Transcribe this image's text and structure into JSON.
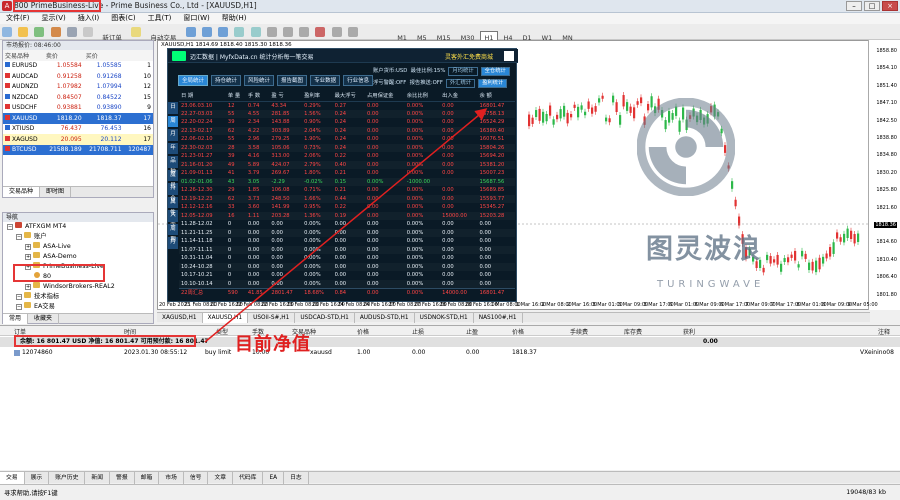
{
  "titlebar": {
    "icon": "A",
    "account": "800",
    "server": "PrimeBusiness-Live",
    "rest": " - Prime Business Co., Ltd - [XAUUSD,H1]"
  },
  "menu": [
    "文件(F)",
    "显示(V)",
    "插入(I)",
    "图表(C)",
    "工具(T)",
    "窗口(W)",
    "帮助(H)"
  ],
  "toolbar": {
    "new_order": "新订单",
    "auto_trade": "自动交易",
    "timeframes": [
      "M1",
      "M5",
      "M15",
      "M30",
      "H1",
      "H4",
      "D1",
      "W1",
      "MN"
    ]
  },
  "market": {
    "header": "市场报价: 08:46:00",
    "cols": [
      "交易品种",
      "卖价",
      "买价",
      ""
    ],
    "rows": [
      {
        "sym": "EURUSD",
        "bid": "1.05584",
        "ask": "1.05585",
        "sp": "1",
        "cls": ""
      },
      {
        "sym": "AUDCAD",
        "bid": "0.91258",
        "ask": "0.91268",
        "sp": "10",
        "cls": ""
      },
      {
        "sym": "AUDNZD",
        "bid": "1.07982",
        "ask": "1.07994",
        "sp": "12",
        "cls": ""
      },
      {
        "sym": "NZDCAD",
        "bid": "0.84507",
        "ask": "0.84522",
        "sp": "15",
        "cls": ""
      },
      {
        "sym": "USDCHF",
        "bid": "0.93881",
        "ask": "0.93890",
        "sp": "9",
        "cls": ""
      },
      {
        "sym": "XAUUSD",
        "bid": "1818.20",
        "ask": "1818.37",
        "sp": "17",
        "cls": "sel"
      },
      {
        "sym": "XTIUSD",
        "bid": "76.437",
        "ask": "76.453",
        "sp": "16",
        "cls": ""
      },
      {
        "sym": "XAGUSD",
        "bid": "20.095",
        "ask": "20.112",
        "sp": "17",
        "cls": "hl"
      },
      {
        "sym": "BTCUSD",
        "bid": "21588.189",
        "ask": "21708.711",
        "sp": "120487",
        "cls": "sel"
      }
    ],
    "tabs": [
      "交易品种",
      "即时图"
    ]
  },
  "navigator": {
    "header": "导航",
    "items": [
      {
        "label": "ATFXGM MT4",
        "indent": 0,
        "type": "root"
      },
      {
        "label": "账户",
        "indent": 1,
        "type": "folder"
      },
      {
        "label": "ASA-Live",
        "indent": 2,
        "type": "folder"
      },
      {
        "label": "ASA-Demo",
        "indent": 2,
        "type": "folder"
      },
      {
        "label": "PrimeBusiness-Live",
        "indent": 2,
        "type": "folder"
      },
      {
        "label": "80",
        "indent": 3,
        "type": "user"
      },
      {
        "label": "WindsorBrokers-REAL2",
        "indent": 2,
        "type": "folder"
      },
      {
        "label": "技术指标",
        "indent": 1,
        "type": "folder"
      },
      {
        "label": "EA交易",
        "indent": 1,
        "type": "folder"
      }
    ],
    "tabs": [
      "常用",
      "收藏夹"
    ]
  },
  "chart": {
    "title": "XAUUSD,H1  1814.69 1818.40 1815.30 1818.36",
    "price_labels": [
      "1858.80",
      "1854.10",
      "1851.40",
      "1847.10",
      "1842.50",
      "1838.80",
      "1834.80",
      "1830.20",
      "1825.80",
      "1821.60",
      "1818.36",
      "1814.60",
      "1810.40",
      "1806.40",
      "1801.80"
    ],
    "current_price": "1818.36",
    "time_labels": [
      "20 Feb 2023",
      "21 Feb 08:00",
      "21 Feb 16:00",
      "22 Feb 08:00",
      "22 Feb 16:00",
      "23 Feb 08:00",
      "23 Feb 16:00",
      "24 Feb 08:00",
      "24 Feb 16:00",
      "27 Feb 08:00",
      "27 Feb 16:00",
      "28 Feb 08:00",
      "28 Feb 16:00",
      "1 Mar 08:00",
      "1 Mar 16:00",
      "2 Mar 08:00",
      "2 Mar 16:00",
      "3 Mar 01:00",
      "3 Mar 09:00",
      "3 Mar 17:00",
      "6 Mar 01:00",
      "6 Mar 09:00",
      "6 Mar 17:00",
      "7 Mar 09:00",
      "7 Mar 17:00",
      "8 Mar 01:00",
      "8 Mar 09:00",
      "9 Mar 05:00"
    ],
    "watermark": {
      "cn": "图灵波浪",
      "en": "TURINGWAVE"
    }
  },
  "overlay": {
    "brand": "迈汇数据 | MyfxData.cn  统计分析每一笔交易",
    "promo": "灵客外汇免费商城",
    "nav_buttons": [
      "全局统计",
      "持仓统计",
      "风险统计",
      "报告截图",
      "专业数据",
      "行业信息"
    ],
    "stats": {
      "currency_label": "账户货币:USD",
      "margin_label": "最佳比例:15%",
      "chips1": [
        "月均统计",
        "全仓统计"
      ],
      "hedge_label": "浮亏警醒:OFF",
      "alert_label": "报告推送:OFF",
      "chips2": [
        "外汇统计",
        "盈利统计"
      ]
    },
    "side_tabs": [
      "日",
      "周",
      "月",
      "年",
      "品种",
      "魔号",
      "持仓",
      "属性",
      "大字",
      "周期",
      "月"
    ],
    "columns": [
      "日 期",
      "单 量",
      "手 数",
      "盈 亏",
      "盈利率",
      "最大浮亏",
      "占用保证金",
      "余比比例",
      "出入金",
      "余 额"
    ],
    "rows": [
      {
        "c": [
          "23.06.03.10",
          "12",
          "0.74",
          "43.34",
          "0.29%",
          "0.27",
          "0.00",
          "0.00%",
          "0.00",
          "16801.47"
        ],
        "k": "r"
      },
      {
        "c": [
          "22.27-03.03",
          "55",
          "4.55",
          "281.85",
          "1.56%",
          "0.24",
          "0.00",
          "0.00%",
          "0.00",
          "16758.13"
        ],
        "k": "r"
      },
      {
        "c": [
          "22.20-02.24",
          "39",
          "2.34",
          "143.88",
          "0.90%",
          "0.24",
          "0.00",
          "0.00%",
          "0.00",
          "16524.29"
        ],
        "k": "r"
      },
      {
        "c": [
          "22.13-02.17",
          "62",
          "4.22",
          "303.89",
          "2.04%",
          "0.24",
          "0.00",
          "0.00%",
          "0.00",
          "16380.40"
        ],
        "k": "r"
      },
      {
        "c": [
          "22.06-02.10",
          "55",
          "2.96",
          "279.25",
          "1.90%",
          "0.24",
          "0.00",
          "0.00%",
          "0.00",
          "16076.51"
        ],
        "k": "r"
      },
      {
        "c": [
          "22.30-02.03",
          "28",
          "3.58",
          "105.06",
          "0.73%",
          "0.24",
          "0.00",
          "0.00%",
          "0.00",
          "15804.26"
        ],
        "k": "r"
      },
      {
        "c": [
          "21.23-01.27",
          "39",
          "4.16",
          "313.00",
          "2.06%",
          "0.22",
          "0.00",
          "0.00%",
          "0.00",
          "15694.20"
        ],
        "k": "r"
      },
      {
        "c": [
          "21.16-01.20",
          "49",
          "5.89",
          "424.07",
          "2.79%",
          "0.40",
          "0.00",
          "0.00%",
          "0.00",
          "15381.20"
        ],
        "k": "r"
      },
      {
        "c": [
          "21.09-01.13",
          "41",
          "3.79",
          "269.67",
          "1.80%",
          "0.21",
          "0.00",
          "0.00%",
          "0.00",
          "15007.23"
        ],
        "k": "r"
      },
      {
        "c": [
          "01.02-01.06",
          "43",
          "3.05",
          "-2.29",
          "-0.02%",
          "0.15",
          "0.00%",
          "-1000.00",
          "",
          "15687.56"
        ],
        "k": "g"
      },
      {
        "c": [
          "12.26-12.30",
          "29",
          "1.85",
          "106.08",
          "0.71%",
          "0.21",
          "0.00",
          "0.00%",
          "0.00",
          "15689.85"
        ],
        "k": "r"
      },
      {
        "c": [
          "12.19-12.23",
          "62",
          "3.73",
          "248.50",
          "1.66%",
          "0.44",
          "0.00",
          "0.00%",
          "0.00",
          "15593.77"
        ],
        "k": "r"
      },
      {
        "c": [
          "12.12-12.16",
          "33",
          "3.60",
          "141.99",
          "0.95%",
          "0.22",
          "0.00",
          "0.00%",
          "0.00",
          "15345.27"
        ],
        "k": "r"
      },
      {
        "c": [
          "12.05-12.09",
          "16",
          "1.11",
          "203.28",
          "1.36%",
          "0.19",
          "0.00",
          "0.00%",
          "15000.00",
          "15203.28"
        ],
        "k": "r"
      },
      {
        "c": [
          "11.28-12.02",
          "0",
          "0.00",
          "0.00",
          "0.00%",
          "0.00",
          "0.00",
          "0.00%",
          "0.00",
          "0.00"
        ],
        "k": "w"
      },
      {
        "c": [
          "11.21-11.25",
          "0",
          "0.00",
          "0.00",
          "0.00%",
          "0.00",
          "0.00",
          "0.00%",
          "0.00",
          "0.00"
        ],
        "k": "w"
      },
      {
        "c": [
          "11.14-11.18",
          "0",
          "0.00",
          "0.00",
          "0.00%",
          "0.00",
          "0.00",
          "0.00%",
          "0.00",
          "0.00"
        ],
        "k": "w"
      },
      {
        "c": [
          "11.07-11.11",
          "0",
          "0.00",
          "0.00",
          "0.00%",
          "0.00",
          "0.00",
          "0.00%",
          "0.00",
          "0.00"
        ],
        "k": "w"
      },
      {
        "c": [
          "10.31-11.04",
          "0",
          "0.00",
          "0.00",
          "0.00%",
          "0.00",
          "0.00",
          "0.00%",
          "0.00",
          "0.00"
        ],
        "k": "w"
      },
      {
        "c": [
          "10.24-10.28",
          "0",
          "0.00",
          "0.00",
          "0.00%",
          "0.00",
          "0.00",
          "0.00%",
          "0.00",
          "0.00"
        ],
        "k": "w"
      },
      {
        "c": [
          "10.17-10.21",
          "0",
          "0.00",
          "0.00",
          "0.00%",
          "0.00",
          "0.00",
          "0.00%",
          "0.00",
          "0.00"
        ],
        "k": "w"
      },
      {
        "c": [
          "10.10-10.14",
          "0",
          "0.00",
          "0.00",
          "0.00%",
          "0.00",
          "0.00",
          "0.00%",
          "0.00",
          "0.00"
        ],
        "k": "w"
      },
      {
        "c": [
          "22周汇总",
          "590",
          "41.85",
          "2801.47",
          "18.68%",
          "0.84",
          "0.00",
          "0.00%",
          "14000.00",
          "16801.47"
        ],
        "k": "t"
      }
    ]
  },
  "chart_tabs": [
    "XAGUSD,H1",
    "XAUUSD,H1",
    "USOil-S#,H1",
    "USDCAD-STD,H1",
    "AUDUSD-STD,H1",
    "USDNOK-STD,H1",
    "NAS100#,H1"
  ],
  "terminal": {
    "columns": [
      "订单",
      "时间",
      "类型",
      "手数",
      "交易品种",
      "价格",
      "止损",
      "止盈",
      "价格",
      "手续费",
      "库存费",
      "获利",
      "注释"
    ],
    "balance_text": "余额: 16 801.47 USD  净值: 16 801.47  可用预付款: 16 801.47",
    "balance_total": "0.00",
    "order": {
      "id": "12074860",
      "time": "2023.01.30 08:55:12",
      "type": "buy limit",
      "lots": "10.00",
      "symbol": "xauusd",
      "price": "1.00",
      "sl": "0.00",
      "tp": "0.00",
      "cur": "1818.37",
      "comment": "VXeinino08"
    }
  },
  "annotation": "目前净值",
  "bottom_tabs": [
    "交易",
    "展示",
    "账户历史",
    "新闻",
    "警报",
    "邮箱",
    "市场",
    "信号",
    "文章",
    "代码库",
    "EA",
    "日志"
  ],
  "status": {
    "help": "寻求帮助,请按F1键",
    "traffic": "19048/83 kb"
  },
  "colors": {
    "highlight": "#e53535",
    "bull": "#2db84a",
    "bear": "#e23232"
  }
}
